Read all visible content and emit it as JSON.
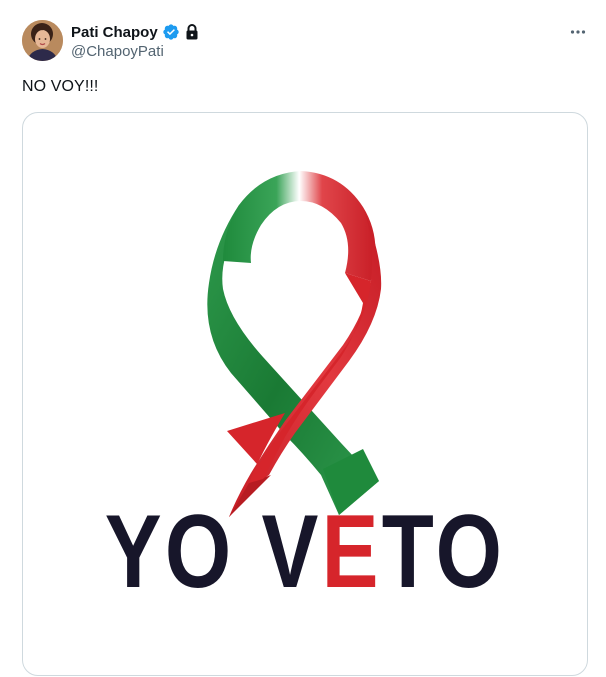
{
  "author": {
    "display_name": "Pati Chapoy",
    "handle": "@ChapoyPati",
    "verified": true,
    "protected": true
  },
  "tweet": {
    "text": "NO VOY!!!"
  },
  "media": {
    "image_text_part1": "YO V",
    "image_text_highlight": "E",
    "image_text_part2": "TO",
    "ribbon_colors": [
      "#1f8a3c",
      "#ffffff",
      "#d6252b"
    ],
    "text_color": "#17162a",
    "highlight_color": "#d6252b"
  },
  "colors": {
    "verified_blue": "#1d9bf0",
    "handle_gray": "#536471",
    "border": "#cfd9de"
  },
  "icons": {
    "verified": "verified-badge-icon",
    "lock": "lock-icon",
    "more": "more-options-icon"
  }
}
